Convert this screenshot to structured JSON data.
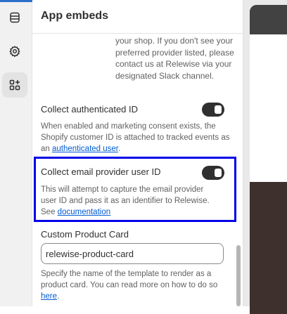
{
  "panel": {
    "title": "App embeds",
    "provider_help": "your shop. If you don't see your preferred provider listed, please contact us at Relewise via your designated Slack channel."
  },
  "settings": {
    "auth_id": {
      "label": "Collect authenticated ID",
      "enabled": true,
      "desc_pre": "When enabled and marketing consent exists, the Shopify customer ID is attached to tracked events as an ",
      "link": "authenticated user",
      "desc_post": "."
    },
    "email_id": {
      "label": "Collect email provider user ID",
      "enabled": true,
      "desc_pre": "This will attempt to capture the email provider user ID and pass it as an identifier to Relewise. See ",
      "link": "documentation",
      "desc_post": ""
    },
    "product_card": {
      "label": "Custom Product Card",
      "value": "relewise-product-card",
      "desc_pre": "Specify the name of the template to render as a product card. You can read more on how to do so ",
      "link": "here",
      "desc_post": "."
    }
  },
  "icons": {
    "sections": "sections-icon",
    "settings": "gear-icon",
    "apps": "apps-icon"
  },
  "colors": {
    "accent": "#2c6ecb",
    "highlight": "#0000e8",
    "link": "#005bd3",
    "toggle_on": "#303030"
  }
}
